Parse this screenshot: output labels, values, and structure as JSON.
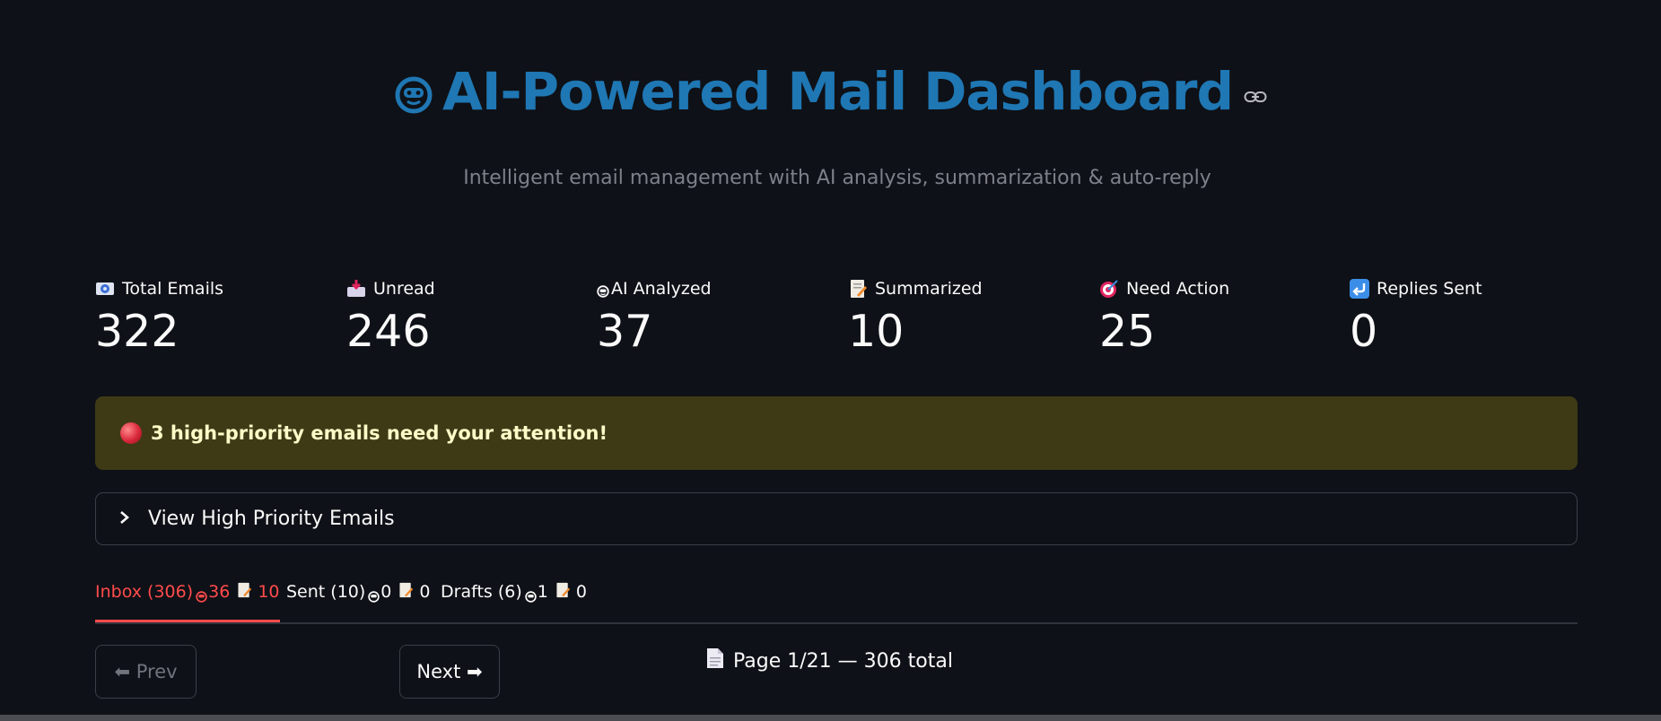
{
  "header": {
    "title": "AI-Powered Mail Dashboard",
    "subtitle": "Intelligent email management with AI analysis, summarization & auto-reply",
    "title_color": "#1f77b4"
  },
  "metrics": [
    {
      "icon": "email-icon",
      "label": "Total Emails",
      "value": "322"
    },
    {
      "icon": "inbox-tray-icon",
      "label": "Unread",
      "value": "246"
    },
    {
      "icon": "robot-icon",
      "label": "AI Analyzed",
      "value": "37"
    },
    {
      "icon": "memo-icon",
      "label": "Summarized",
      "value": "10"
    },
    {
      "icon": "target-icon",
      "label": "Need Action",
      "value": "25"
    },
    {
      "icon": "reply-arrow-icon",
      "label": "Replies Sent",
      "value": "0"
    }
  ],
  "alert": {
    "icon": "red-circle-icon",
    "text": "3 high-priority emails need your attention!",
    "background": "#3e3a16",
    "text_color": "#fffbc8"
  },
  "expander": {
    "label": "View High Priority Emails"
  },
  "tabs": [
    {
      "name": "Inbox (306)",
      "analyzed": "36",
      "summarized": "10",
      "active": true
    },
    {
      "name": "Sent (10)",
      "analyzed": "0",
      "summarized": "0",
      "active": false
    },
    {
      "name": "Drafts (6)",
      "analyzed": "1",
      "summarized": "0",
      "active": false
    }
  ],
  "pagination": {
    "prev_label": "⬅ Prev",
    "next_label": "Next ➡",
    "page_text": "Page 1/21 — 306 total"
  },
  "colors": {
    "background": "#0e1117",
    "accent": "#ff4b4b"
  }
}
